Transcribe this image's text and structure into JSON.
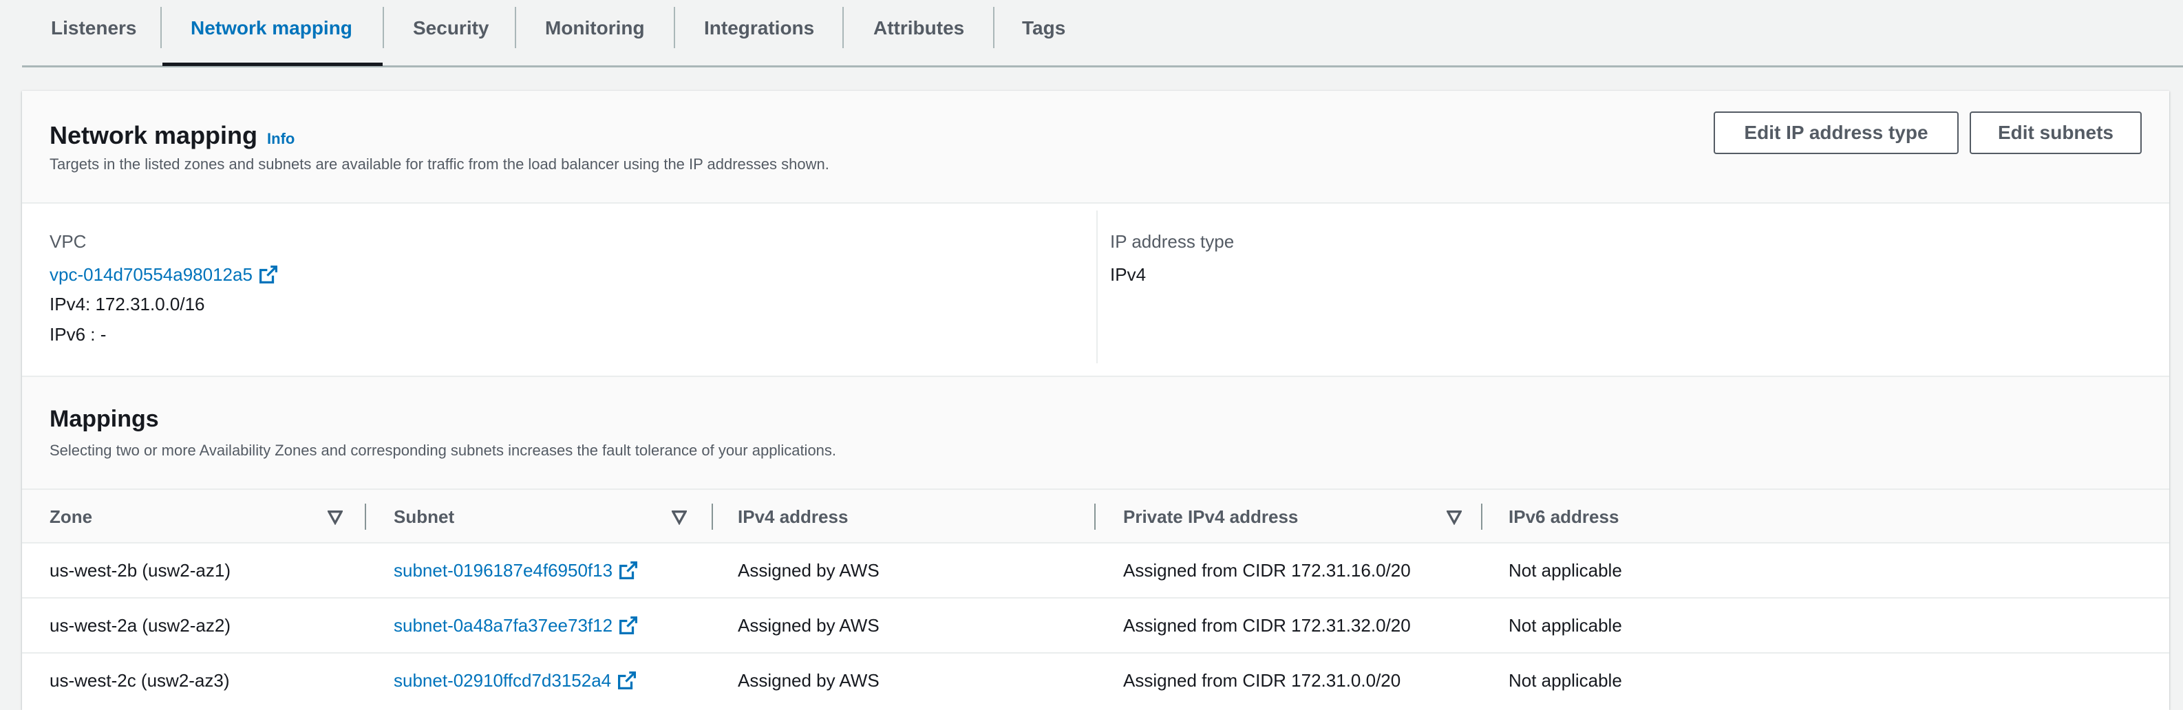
{
  "tabs": [
    {
      "label": "Listeners",
      "active": false
    },
    {
      "label": "Network mapping",
      "active": true
    },
    {
      "label": "Security",
      "active": false
    },
    {
      "label": "Monitoring",
      "active": false
    },
    {
      "label": "Integrations",
      "active": false
    },
    {
      "label": "Attributes",
      "active": false
    },
    {
      "label": "Tags",
      "active": false
    }
  ],
  "network_mapping": {
    "title": "Network mapping",
    "info_label": "Info",
    "description": "Targets in the listed zones and subnets are available for traffic from the load balancer using the IP addresses shown.",
    "edit_ip_type_label": "Edit IP address type",
    "edit_subnets_label": "Edit subnets",
    "vpc_label": "VPC",
    "vpc_id": "vpc-014d70554a98012a5",
    "ipv4": "IPv4: 172.31.0.0/16",
    "ipv6": "IPv6 : -",
    "ip_type_label": "IP address type",
    "ip_type_value": "IPv4"
  },
  "mappings": {
    "title": "Mappings",
    "description": "Selecting two or more Availability Zones and corresponding subnets increases the fault tolerance of your applications.",
    "columns": [
      "Zone",
      "Subnet",
      "IPv4 address",
      "Private IPv4 address",
      "IPv6 address"
    ],
    "rows": [
      {
        "zone": "us-west-2b (usw2-az1)",
        "subnet": "subnet-0196187e4f6950f13",
        "ipv4": "Assigned by AWS",
        "private": "Assigned from CIDR 172.31.16.0/20",
        "ipv6": "Not applicable"
      },
      {
        "zone": "us-west-2a (usw2-az2)",
        "subnet": "subnet-0a48a7fa37ee73f12",
        "ipv4": "Assigned by AWS",
        "private": "Assigned from CIDR 172.31.32.0/20",
        "ipv6": "Not applicable"
      },
      {
        "zone": "us-west-2c (usw2-az3)",
        "subnet": "subnet-02910ffcd7d3152a4",
        "ipv4": "Assigned by AWS",
        "private": "Assigned from CIDR 172.31.0.0/20",
        "ipv6": "Not applicable"
      }
    ]
  },
  "colors": {
    "link": "#0073bb",
    "text": "#16191f",
    "muted": "#545b64"
  }
}
